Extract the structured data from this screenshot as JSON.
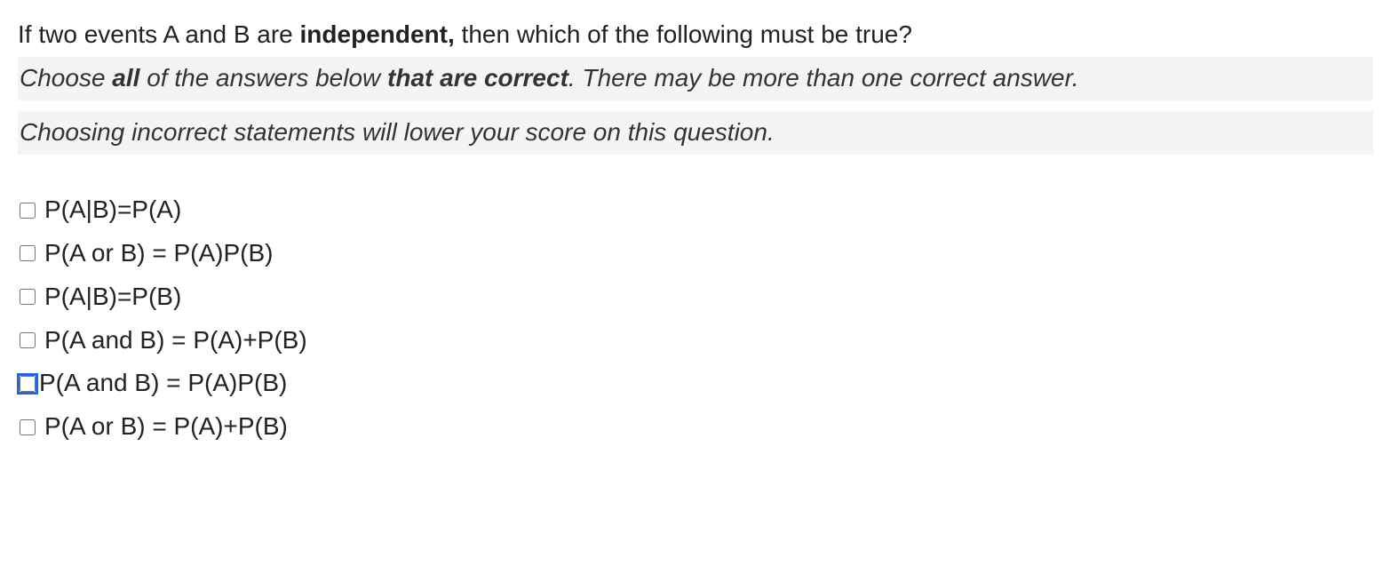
{
  "question": {
    "prefix": "If two events A and B are ",
    "bold_word": "independent,",
    "suffix": " then which of the following must be true?"
  },
  "instruction1": {
    "prefix": "Choose ",
    "bold1": "all",
    "mid": " of the answers below ",
    "bold2": "that are correct",
    "suffix": ".  There may be more than one correct answer."
  },
  "instruction2": "Choosing incorrect statements will lower your score on this question.",
  "answers": [
    {
      "label": "P(A|B)=P(A)",
      "checked": false,
      "focused": false
    },
    {
      "label": "P(A or B) = P(A)P(B)",
      "checked": false,
      "focused": false
    },
    {
      "label": "P(A|B)=P(B)",
      "checked": false,
      "focused": false
    },
    {
      "label": "P(A and B) = P(A)+P(B)",
      "checked": false,
      "focused": false
    },
    {
      "label": "P(A and B) = P(A)P(B)",
      "checked": false,
      "focused": true
    },
    {
      "label": "P(A or B) = P(A)+P(B)",
      "checked": false,
      "focused": false
    }
  ]
}
